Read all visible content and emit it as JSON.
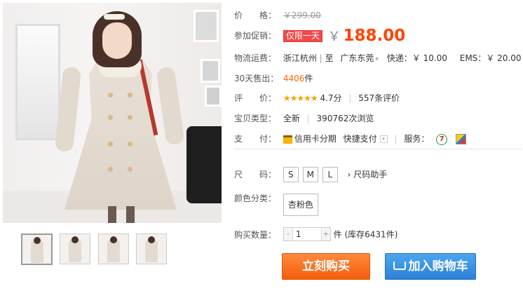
{
  "price": {
    "label": "价　　格：",
    "original": "￥299.00"
  },
  "promo": {
    "label": "参加促销：",
    "tag": "仅限一天",
    "currency": "￥",
    "price": "188.00"
  },
  "shipping": {
    "label": "物流运费：",
    "from": "浙江杭州",
    "to_prefix": "至",
    "to": "广东东莞",
    "express": "快递：￥ 10.00",
    "ems": "EMS：￥ 20.00"
  },
  "sales": {
    "label": "30天售出：",
    "count": "4406",
    "unit": "件"
  },
  "rating": {
    "label": "评　　价：",
    "stars": "★★★★★",
    "score": "4.7分",
    "reviews": "557条评价"
  },
  "item_type": {
    "label": "宝贝类型：",
    "condition": "全新",
    "views": "390762次浏览"
  },
  "payment": {
    "label": "支　　付：",
    "credit": "信用卡分期",
    "quick": "快捷支付",
    "service_label": "服务：",
    "service_7": "7"
  },
  "size": {
    "label": "尺　　码：",
    "options": [
      "S",
      "M",
      "L"
    ],
    "helper": "› 尺码助手"
  },
  "color": {
    "label": "颜色分类：",
    "option": "杏粉色"
  },
  "quantity": {
    "label": "购买数量：",
    "minus": "-",
    "value": "1",
    "plus": "+",
    "stock": "件 (库存6431件)"
  },
  "actions": {
    "buy": "立刻购买",
    "cart": "加入购物车"
  },
  "colors": {
    "price_red": "#ff4400",
    "buy_orange": "#f55e0c",
    "cart_blue": "#2c82d6"
  }
}
